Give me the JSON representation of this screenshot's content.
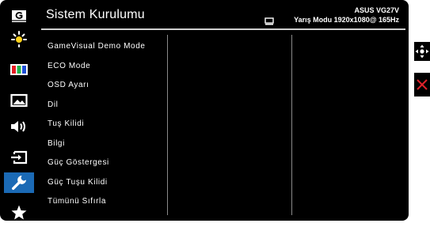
{
  "header": {
    "title": "Sistem Kurulumu",
    "model": "ASUS  VG27V",
    "mode_line": "Yarış Modu 1920x1080@ 165Hz"
  },
  "sidebar": {
    "items": [
      {
        "icon": "gamevisual-g-icon",
        "active": false
      },
      {
        "icon": "brightness-icon",
        "active": false
      },
      {
        "icon": "color-bars-icon",
        "active": false
      },
      {
        "icon": "image-icon",
        "active": false
      },
      {
        "icon": "sound-icon",
        "active": false
      },
      {
        "icon": "input-select-icon",
        "active": false
      },
      {
        "icon": "wrench-icon",
        "active": true
      },
      {
        "icon": "star-icon",
        "active": false
      }
    ]
  },
  "menu": {
    "items": [
      {
        "label": "GameVisual Demo Mode"
      },
      {
        "label": "ECO Mode"
      },
      {
        "label": "OSD Ayarı"
      },
      {
        "label": "Dil"
      },
      {
        "label": "Tuş Kilidi"
      },
      {
        "label": "Bilgi"
      },
      {
        "label": "Güç Göstergesi"
      },
      {
        "label": "Güç Tuşu Kilidi"
      },
      {
        "label": "Tümünü Sıfırla"
      }
    ]
  },
  "controls": {
    "nav_icon": "move-arrows-icon",
    "close_icon": "close-x-icon"
  },
  "colors": {
    "background": "#000000",
    "active_item": "#1b6ab5",
    "close_red": "#e0222a",
    "divider": "#cfcfcf"
  }
}
